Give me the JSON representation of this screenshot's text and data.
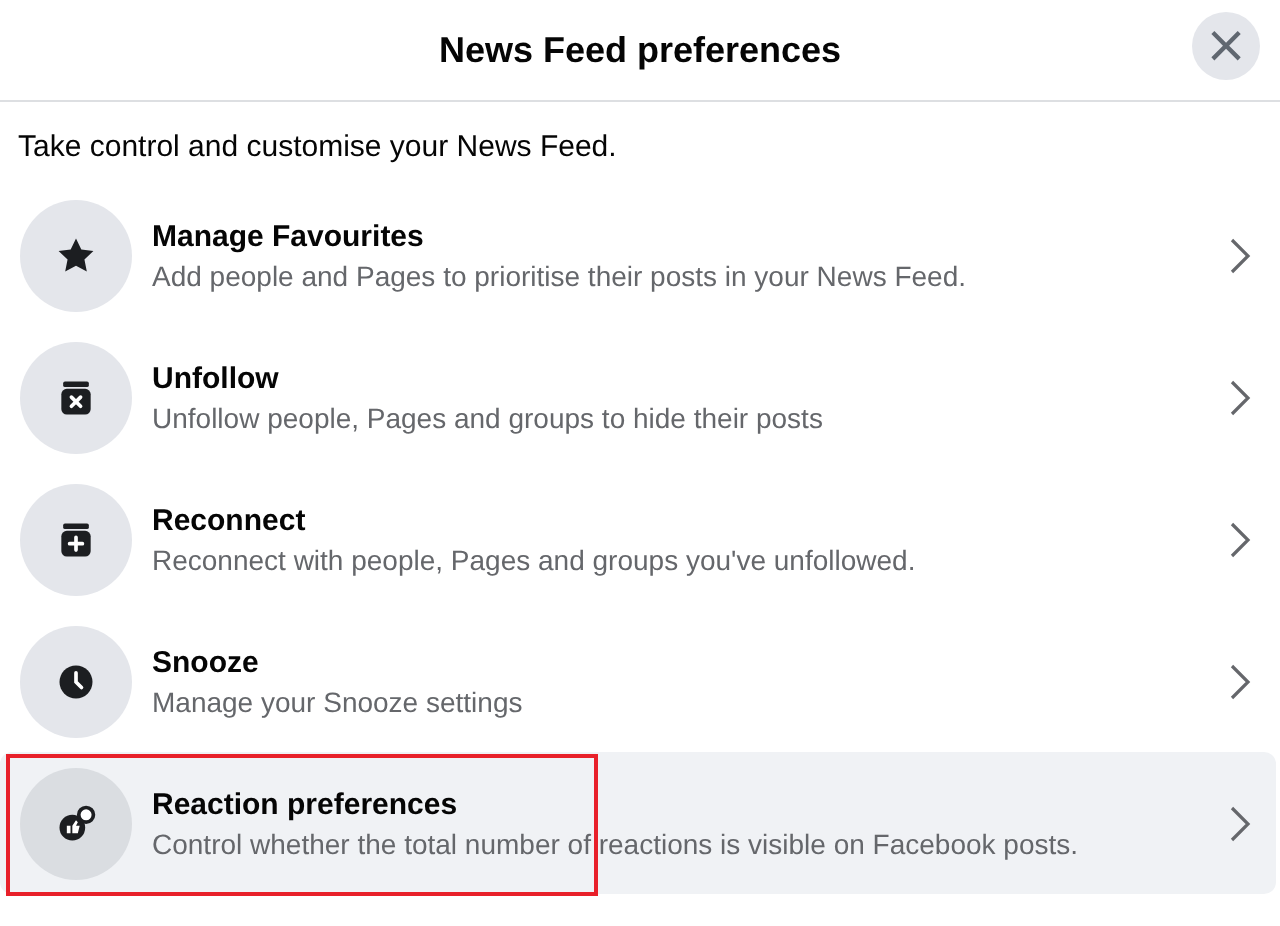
{
  "dialog": {
    "title": "News Feed preferences",
    "close": "×"
  },
  "intro": "Take control and customise your News Feed.",
  "items": [
    {
      "kind": "star",
      "title": "Manage Favourites",
      "description": "Add people and Pages to prioritise their posts in your News Feed.",
      "selected": false,
      "outlined": false
    },
    {
      "kind": "unfollow",
      "title": "Unfollow",
      "description": "Unfollow people, Pages and groups to hide their posts",
      "selected": false,
      "outlined": false
    },
    {
      "kind": "reconnect",
      "title": "Reconnect",
      "description": "Reconnect with people, Pages and groups you've unfollowed.",
      "selected": false,
      "outlined": false
    },
    {
      "kind": "clock",
      "title": "Snooze",
      "description": "Manage your Snooze settings",
      "selected": false,
      "outlined": false
    },
    {
      "kind": "reaction",
      "title": "Reaction preferences",
      "description": "Control whether the total number of reactions is visible on Facebook posts.",
      "selected": true,
      "outlined": true
    }
  ]
}
